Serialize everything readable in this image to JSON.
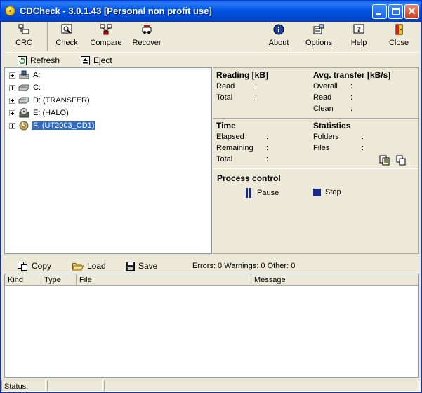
{
  "window": {
    "title": "CDCheck - 3.0.1.43 [Personal non profit use]",
    "title_color": "#0055e5"
  },
  "toolbar": {
    "crc": "CRC",
    "check": "Check",
    "compare": "Compare",
    "recover": "Recover",
    "about": "About",
    "options": "Options",
    "help": "Help",
    "close": "Close"
  },
  "drivebar": {
    "refresh": "Refresh",
    "eject": "Eject"
  },
  "tree": {
    "items": [
      {
        "label": "A:",
        "icon": "floppy-drive-icon"
      },
      {
        "label": "C:",
        "icon": "hard-disk-icon"
      },
      {
        "label": "D: (TRANSFER)",
        "icon": "hard-disk-icon"
      },
      {
        "label": "E: (HALO)",
        "icon": "cd-drive-icon"
      },
      {
        "label": "F: (UT2003_CD1)",
        "icon": "cd-drive-icon",
        "selected": true
      }
    ],
    "selection_color": "#316ac5"
  },
  "panel": {
    "reading_title": "Reading [kB]",
    "reading_read": "Read",
    "reading_total": "Total",
    "avg_title": "Avg. transfer [kB/s]",
    "avg_overall": "Overall",
    "avg_read": "Read",
    "avg_clean": "Clean",
    "time_title": "Time",
    "time_elapsed": "Elapsed",
    "time_remaining": "Remaining",
    "time_total": "Total",
    "stats_title": "Statistics",
    "stats_folders": "Folders",
    "stats_files": "Files",
    "colon": ":",
    "process_title": "Process control",
    "pause": "Pause",
    "stop": "Stop"
  },
  "logbar": {
    "copy": "Copy",
    "load": "Load",
    "save": "Save",
    "summary": "Errors: 0 Warnings: 0 Other: 0"
  },
  "log": {
    "columns": [
      "Kind",
      "Type",
      "File",
      "Message"
    ]
  },
  "status": {
    "label": "Status:"
  }
}
